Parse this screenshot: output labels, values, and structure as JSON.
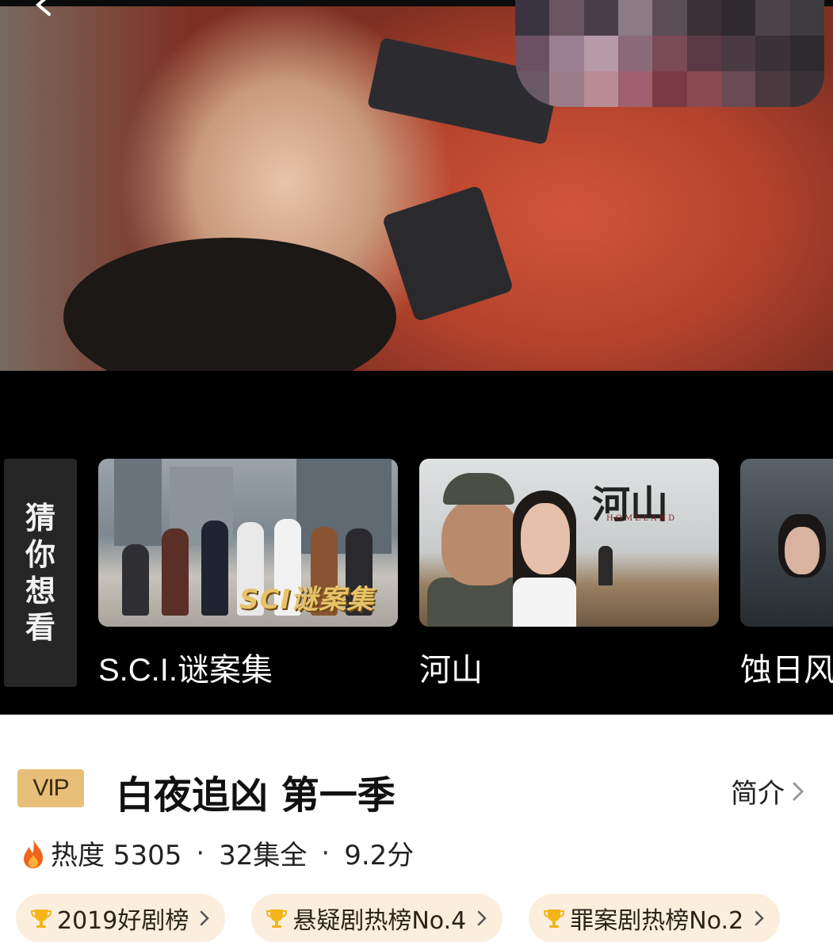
{
  "player": {
    "back_icon": "chevron-left-icon"
  },
  "recommendations": {
    "section_label": "猜你想看",
    "items": [
      {
        "title": "S.C.I.谜案集",
        "poster_text": "SCI谜案集"
      },
      {
        "title": "河山",
        "poster_text": "河山",
        "poster_subtext": "HOMELAND"
      },
      {
        "title": "蚀日风"
      }
    ]
  },
  "show": {
    "vip_label": "VIP",
    "title": "白夜追凶 第一季",
    "intro_label": "简介",
    "heat_label": "热度 5305",
    "episodes": "32集全",
    "score": "9.2分",
    "separator": "·",
    "badges": [
      {
        "label": "2019好剧榜"
      },
      {
        "label": "悬疑剧热榜No.4"
      },
      {
        "label": "罪案剧热榜No.2"
      }
    ]
  },
  "colors": {
    "vip_bg": "#e8bf78",
    "badge_bg": "#fbeedd",
    "trophy": "#f4b41a",
    "flame": "#f0641e"
  }
}
